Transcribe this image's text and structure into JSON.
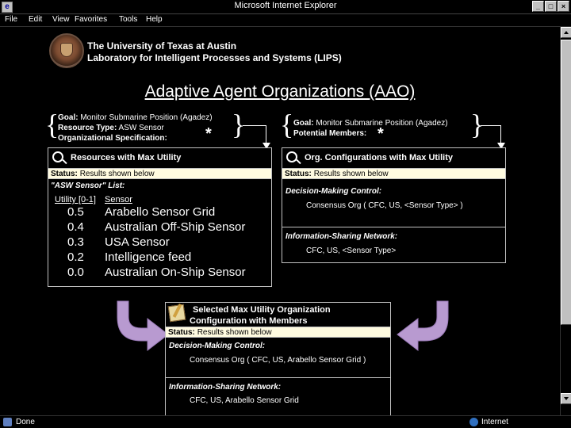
{
  "window": {
    "title": "Microsoft Internet Explorer",
    "app_icon": "ie-app-icon",
    "minimize": "_",
    "maximize": "□",
    "close": "×"
  },
  "menu": [
    "File",
    "Edit",
    "View",
    "Favorites",
    "Tools",
    "Help"
  ],
  "header": {
    "university": "The University of Texas at Austin",
    "lab": "Laboratory for Intelligent Processes and Systems (LIPS)",
    "title": "Adaptive Agent Organizations (AAO)"
  },
  "left_goal": {
    "goal_label": "Goal:",
    "goal_value": "Monitor Submarine Position (Agadez)",
    "resource_label": "Resource Type:",
    "resource_value": "ASW Sensor",
    "spec_label": "Organizational Specification:",
    "star": "*"
  },
  "right_goal": {
    "goal_label": "Goal:",
    "goal_value": "Monitor Submarine Position (Agadez)",
    "members_label": "Potential Members:",
    "star": "*"
  },
  "resources_panel": {
    "title": "Resources with Max Utility",
    "status_label": "Status:",
    "status_value": "Results shown below",
    "list_title": "\"ASW Sensor\" List:",
    "col_utility": "Utility [0-1]",
    "col_sensor": "Sensor",
    "rows": [
      {
        "utility": "0.5",
        "sensor": "Arabello Sensor Grid"
      },
      {
        "utility": "0.4",
        "sensor": "Australian Off-Ship Sensor"
      },
      {
        "utility": "0.3",
        "sensor": "USA Sensor"
      },
      {
        "utility": "0.2",
        "sensor": "Intelligence feed"
      },
      {
        "utility": "0.0",
        "sensor": "Australian On-Ship Sensor"
      }
    ]
  },
  "config_panel": {
    "title": "Org. Configurations with Max Utility",
    "status_label": "Status:",
    "status_value": "Results shown below",
    "dmc_label": "Decision-Making Control:",
    "dmc_value": "Consensus Org ( CFC, US, <Sensor Type> )",
    "isn_label": "Information-Sharing Network:",
    "isn_value": "CFC, US, <Sensor Type>"
  },
  "selected_panel": {
    "title_line1": "Selected Max Utility Organization",
    "title_line2": "Configuration with Members",
    "status_label": "Status:",
    "status_value": "Results shown below",
    "dmc_label": "Decision-Making Control:",
    "dmc_value": "Consensus Org ( CFC, US, Arabello Sensor Grid )",
    "isn_label": "Information-Sharing Network:",
    "isn_value": "CFC, US, Arabello Sensor Grid"
  },
  "colors": {
    "status_bg": "#fffbe0",
    "arrow_purple": "#b89ad0"
  },
  "statusbar": {
    "left": "Done",
    "zone": "Internet"
  }
}
